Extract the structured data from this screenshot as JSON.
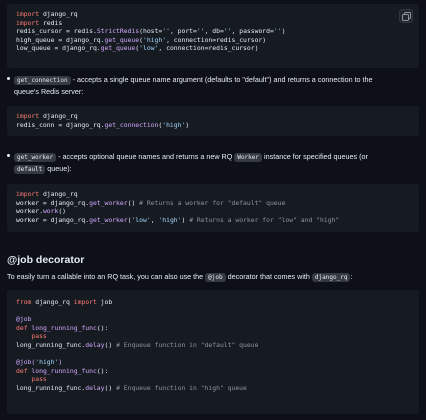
{
  "block1": {
    "lines": [
      [
        {
          "t": "import",
          "c": "kw"
        },
        {
          "t": " django_rq"
        }
      ],
      [
        {
          "t": "import",
          "c": "kw"
        },
        {
          "t": " redis"
        }
      ],
      [
        {
          "t": "redis_cursor = redis."
        },
        {
          "t": "StrictRedis",
          "c": "fn"
        },
        {
          "t": "(host="
        },
        {
          "t": "''",
          "c": "str"
        },
        {
          "t": ", port="
        },
        {
          "t": "''",
          "c": "str"
        },
        {
          "t": ", db="
        },
        {
          "t": "''",
          "c": "str"
        },
        {
          "t": ", password="
        },
        {
          "t": "''",
          "c": "str"
        },
        {
          "t": ")"
        }
      ],
      [
        {
          "t": "high_queue = django_rq."
        },
        {
          "t": "get_queue",
          "c": "fn"
        },
        {
          "t": "("
        },
        {
          "t": "'high'",
          "c": "str"
        },
        {
          "t": ", connection=redis_cursor)"
        }
      ],
      [
        {
          "t": "low_queue = django_rq."
        },
        {
          "t": "get_queue",
          "c": "fn"
        },
        {
          "t": "("
        },
        {
          "t": "'low'",
          "c": "str"
        },
        {
          "t": ", connection=redis_cursor)"
        }
      ]
    ]
  },
  "bullet1": {
    "code": "get_connection",
    "text_a": " - accepts a single queue name argument (defaults to \"default\") and returns a connection to the",
    "text_b": "queue's Redis server:"
  },
  "block2": {
    "lines": [
      [
        {
          "t": "import",
          "c": "kw"
        },
        {
          "t": " django_rq"
        }
      ],
      [
        {
          "t": "redis_conn = django_rq."
        },
        {
          "t": "get_connection",
          "c": "fn"
        },
        {
          "t": "("
        },
        {
          "t": "'high'",
          "c": "str"
        },
        {
          "t": ")"
        }
      ]
    ]
  },
  "bullet2": {
    "code": "get_worker",
    "text_a": " - accepts optional queue names and returns a new RQ ",
    "code2": "Worker",
    "text_b": " instance for specified queues (or",
    "code3": "default",
    "text_c": " queue):"
  },
  "block3": {
    "lines": [
      [
        {
          "t": "import",
          "c": "kw"
        },
        {
          "t": " django_rq"
        }
      ],
      [
        {
          "t": "worker = django_rq."
        },
        {
          "t": "get_worker",
          "c": "fn"
        },
        {
          "t": "() "
        },
        {
          "t": "# Returns a worker for \"default\" queue",
          "c": "cm"
        }
      ],
      [
        {
          "t": "worker."
        },
        {
          "t": "work",
          "c": "fn"
        },
        {
          "t": "()"
        }
      ],
      [
        {
          "t": "worker = django_rq."
        },
        {
          "t": "get_worker",
          "c": "fn"
        },
        {
          "t": "("
        },
        {
          "t": "'low'",
          "c": "str"
        },
        {
          "t": ", "
        },
        {
          "t": "'high'",
          "c": "str"
        },
        {
          "t": ") "
        },
        {
          "t": "# Returns a worker for \"low\" and \"high\"",
          "c": "cm"
        }
      ]
    ]
  },
  "section": {
    "heading": "@job decorator",
    "para_a": "To easily turn a callable into an RQ task, you can also use the ",
    "code1": "@job",
    "para_b": " decorator that comes with ",
    "code2": "django_rq",
    "para_c": ":"
  },
  "block4": {
    "lines": [
      [
        {
          "t": "from",
          "c": "kw"
        },
        {
          "t": " django_rq "
        },
        {
          "t": "import",
          "c": "kw"
        },
        {
          "t": " job"
        }
      ],
      [
        {
          "t": ""
        }
      ],
      [
        {
          "t": "@job",
          "c": "dec"
        }
      ],
      [
        {
          "t": "def",
          "c": "kw"
        },
        {
          "t": " "
        },
        {
          "t": "long_running_func",
          "c": "fn"
        },
        {
          "t": "():"
        }
      ],
      [
        {
          "t": "    "
        },
        {
          "t": "pass",
          "c": "kw"
        }
      ],
      [
        {
          "t": "long_running_func."
        },
        {
          "t": "delay",
          "c": "fn"
        },
        {
          "t": "() "
        },
        {
          "t": "# Enqueue function in \"default\" queue",
          "c": "cm"
        }
      ],
      [
        {
          "t": ""
        }
      ],
      [
        {
          "t": "@job(",
          "c": "dec"
        },
        {
          "t": "'high'",
          "c": "str"
        },
        {
          "t": ")",
          "c": "dec"
        }
      ],
      [
        {
          "t": "def",
          "c": "kw"
        },
        {
          "t": " "
        },
        {
          "t": "long_running_func",
          "c": "fn"
        },
        {
          "t": "():"
        }
      ],
      [
        {
          "t": "    "
        },
        {
          "t": "pass",
          "c": "kw"
        }
      ],
      [
        {
          "t": "long_running_func."
        },
        {
          "t": "delay",
          "c": "fn"
        },
        {
          "t": "() "
        },
        {
          "t": "# Enqueue function in \"high\" queue",
          "c": "cm"
        }
      ]
    ]
  },
  "copy_icon": "copy-icon",
  "colors": {
    "background": "#0d1117",
    "code_bg": "#161b22",
    "keyword": "#ff7b72",
    "function": "#d2a8ff",
    "string": "#a5d6ff",
    "comment": "#8b949e"
  }
}
